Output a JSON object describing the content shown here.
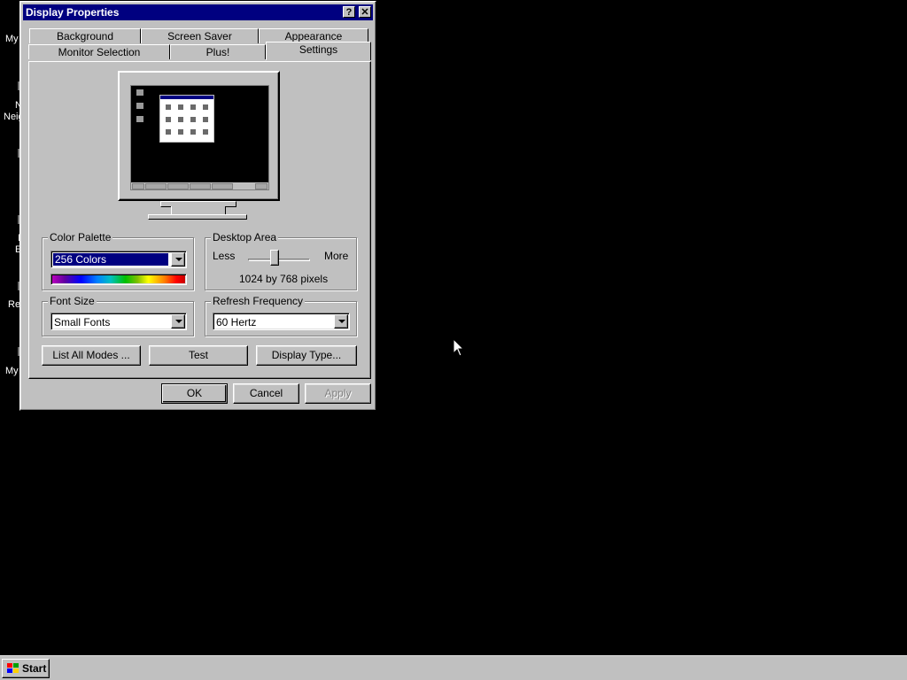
{
  "desktop": {
    "partial_labels": [
      "My",
      "N",
      "Neig",
      "I",
      "E",
      "Re",
      "My"
    ]
  },
  "dialog": {
    "title": "Display Properties",
    "help_button": "?",
    "close_button": "✕",
    "tabs_back": [
      "Background",
      "Screen Saver",
      "Appearance"
    ],
    "tabs_front": [
      "Monitor Selection",
      "Plus!",
      "Settings"
    ],
    "active_tab": "Settings",
    "color_palette": {
      "label": "Color Palette",
      "value": "256 Colors"
    },
    "desktop_area": {
      "label": "Desktop Area",
      "less": "Less",
      "more": "More",
      "resolution": "1024 by 768 pixels"
    },
    "font_size": {
      "label": "Font Size",
      "value": "Small Fonts"
    },
    "refresh_frequency": {
      "label": "Refresh Frequency",
      "value": "60 Hertz"
    },
    "buttons": {
      "list_all_modes": "List All Modes ...",
      "test": "Test",
      "display_type": "Display Type..."
    },
    "footer": {
      "ok": "OK",
      "cancel": "Cancel",
      "apply": "Apply"
    }
  },
  "taskbar": {
    "start_label": "Start"
  },
  "colors": {
    "desktop": "#000000",
    "face": "#c0c0c0",
    "title_bar": "#000080"
  }
}
